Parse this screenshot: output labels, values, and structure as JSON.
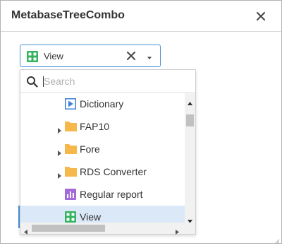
{
  "window": {
    "title": "MetabaseTreeCombo"
  },
  "combo": {
    "value": "View",
    "icon": "view-icon"
  },
  "search": {
    "placeholder": "Search",
    "value": ""
  },
  "tree": {
    "items": [
      {
        "label": "Dictionary",
        "icon": "dictionary-icon",
        "expandable": false
      },
      {
        "label": "FAP10",
        "icon": "folder-icon",
        "expandable": true
      },
      {
        "label": "Fore",
        "icon": "folder-icon",
        "expandable": true
      },
      {
        "label": "RDS Converter",
        "icon": "folder-icon",
        "expandable": true
      },
      {
        "label": "Regular report",
        "icon": "regular-report-icon",
        "expandable": false
      },
      {
        "label": "View",
        "icon": "view-icon",
        "expandable": false,
        "selected": true
      }
    ]
  },
  "colors": {
    "accent": "#4a90d9",
    "selection": "#dae8f8",
    "folder": "#f7b84b",
    "view_icon": "#35b360",
    "report_icon": "#a46bd8",
    "dictionary_icon": "#3b82d6"
  }
}
